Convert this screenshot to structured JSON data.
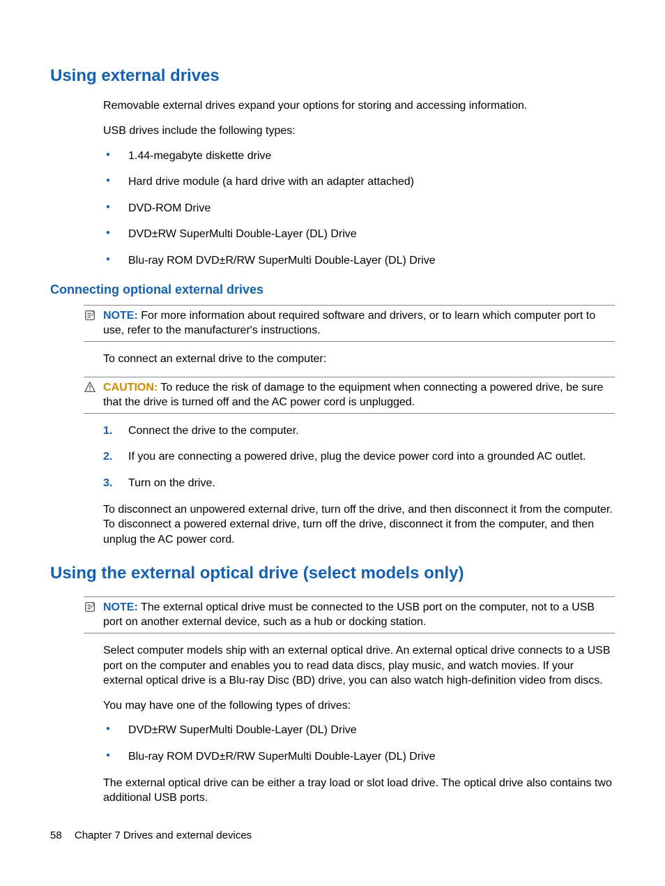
{
  "section1": {
    "heading": "Using external drives",
    "intro1": "Removable external drives expand your options for storing and accessing information.",
    "intro2": "USB drives include the following types:",
    "bullets": [
      "1.44-megabyte diskette drive",
      "Hard drive module (a hard drive with an adapter attached)",
      "DVD-ROM Drive",
      "DVD±RW SuperMulti Double-Layer (DL) Drive",
      "Blu-ray ROM DVD±R/RW SuperMulti Double-Layer (DL) Drive"
    ],
    "sub": {
      "heading": "Connecting optional external drives",
      "note_label": "NOTE:",
      "note_text": "For more information about required software and drivers, or to learn which computer port to use, refer to the manufacturer's instructions.",
      "connect_intro": "To connect an external drive to the computer:",
      "caution_label": "CAUTION:",
      "caution_text": "To reduce the risk of damage to the equipment when connecting a powered drive, be sure that the drive is turned off and the AC power cord is unplugged.",
      "steps": [
        "Connect the drive to the computer.",
        "If you are connecting a powered drive, plug the device power cord into a grounded AC outlet.",
        "Turn on the drive."
      ],
      "disconnect": "To disconnect an unpowered external drive, turn off the drive, and then disconnect it from the computer. To disconnect a powered external drive, turn off the drive, disconnect it from the computer, and then unplug the AC power cord."
    }
  },
  "section2": {
    "heading": "Using the external optical drive (select models only)",
    "note_label": "NOTE:",
    "note_text": "The external optical drive must be connected to the USB port on the computer, not to a USB port on another external device, such as a hub or docking station.",
    "p1": "Select computer models ship with an external optical drive. An external optical drive connects to a USB port on the computer and enables you to read data discs, play music, and watch movies. If your external optical drive is a Blu-ray Disc (BD) drive, you can also watch high-definition video from discs.",
    "p2": "You may have one of the following types of drives:",
    "bullets": [
      "DVD±RW SuperMulti Double-Layer (DL) Drive",
      "Blu-ray ROM DVD±R/RW SuperMulti Double-Layer (DL) Drive"
    ],
    "p3": "The external optical drive can be either a tray load or slot load drive. The optical drive also contains two additional USB ports."
  },
  "footer": {
    "page": "58",
    "chapter": "Chapter 7   Drives and external devices"
  }
}
